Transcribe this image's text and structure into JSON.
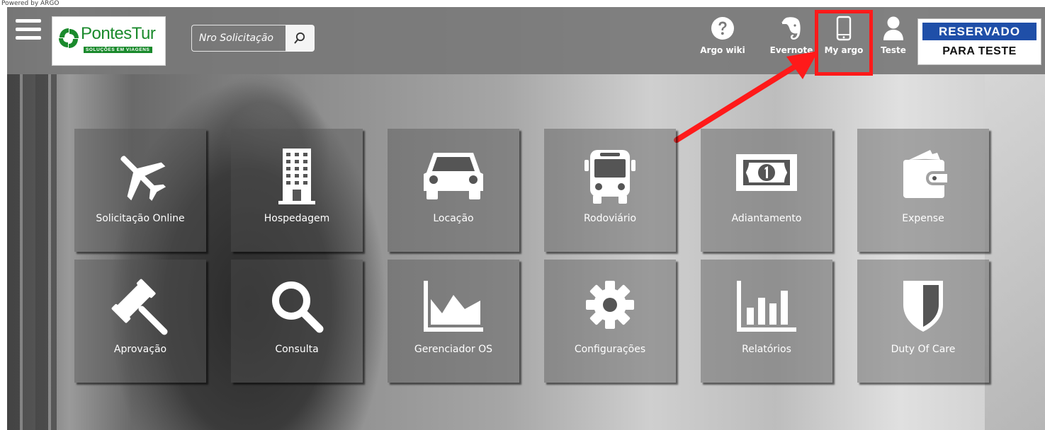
{
  "powered_by": "Powered by ARGO",
  "logo": {
    "name": "PontesTur",
    "tagline": "SOLUÇÕES EM VIAGENS",
    "brand_color": "#1a8a2c"
  },
  "search": {
    "placeholder": "Nro Solicitação",
    "icon": "search-icon"
  },
  "header_items": [
    {
      "label": "Argo wiki",
      "icon": "question-circle-icon"
    },
    {
      "label": "Evernote",
      "icon": "evernote-elephant-icon"
    },
    {
      "label": "My argo",
      "icon": "mobile-phone-icon"
    },
    {
      "label": "Teste",
      "icon": "user-icon"
    }
  ],
  "badge": {
    "line1": "RESERVADO",
    "line2": "PARA TESTE",
    "line1_bg": "#1f4fa8"
  },
  "highlight_color": "#ff1a1a",
  "tiles": [
    {
      "label": "Solicitação Online",
      "icon": "airplane-icon"
    },
    {
      "label": "Hospedagem",
      "icon": "building-icon"
    },
    {
      "label": "Locação",
      "icon": "car-icon"
    },
    {
      "label": "Rodoviário",
      "icon": "bus-icon"
    },
    {
      "label": "Adiantamento",
      "icon": "money-bill-icon"
    },
    {
      "label": "Expense",
      "icon": "wallet-icon"
    },
    {
      "label": "Aprovação",
      "icon": "gavel-icon"
    },
    {
      "label": "Consulta",
      "icon": "magnifier-icon"
    },
    {
      "label": "Gerenciador OS",
      "icon": "area-chart-icon"
    },
    {
      "label": "Configurações",
      "icon": "gear-icon"
    },
    {
      "label": "Relatórios",
      "icon": "bar-chart-icon"
    },
    {
      "label": "Duty Of Care",
      "icon": "shield-icon"
    }
  ]
}
